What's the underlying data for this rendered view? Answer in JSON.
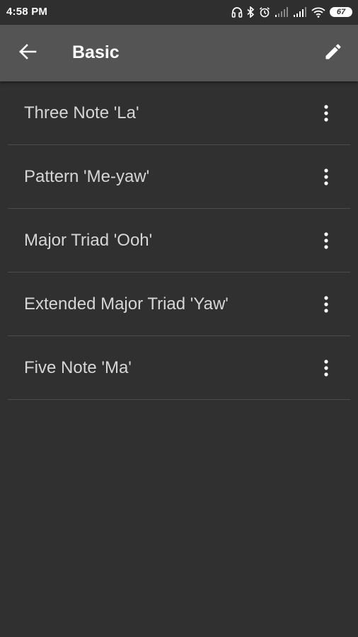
{
  "status_bar": {
    "time": "4:58 PM",
    "battery_level": "67",
    "icons": [
      "headphones-icon",
      "bluetooth-icon",
      "alarm-icon",
      "signal-icon",
      "signal-icon",
      "wifi-icon",
      "battery-icon"
    ]
  },
  "app_bar": {
    "title": "Basic",
    "back_icon": "arrow-back-icon",
    "edit_icon": "pencil-icon"
  },
  "exercises": [
    {
      "label": "Three Note 'La'"
    },
    {
      "label": "Pattern 'Me-yaw'"
    },
    {
      "label": "Major Triad 'Ooh'"
    },
    {
      "label": "Extended Major Triad 'Yaw'"
    },
    {
      "label": "Five Note 'Ma'"
    }
  ],
  "colors": {
    "background": "#303030",
    "app_bar": "#545454",
    "text_primary": "#d6d6d6",
    "divider": "#4c4c4c"
  }
}
